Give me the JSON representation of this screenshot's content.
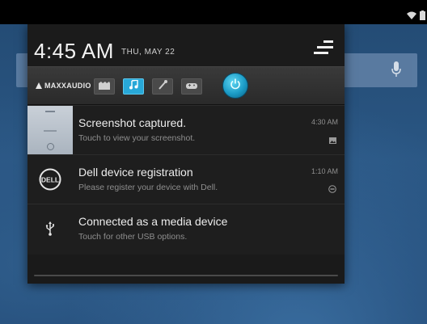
{
  "status_bar": {
    "icons": [
      "wifi-icon",
      "battery-icon"
    ]
  },
  "notification_header": {
    "time": "4:45 AM",
    "date": "THU, MAY 22",
    "quick_settings_icon": "quick-settings-icon"
  },
  "maxx_audio": {
    "label": "MAXXAUDIO",
    "presets": [
      {
        "icon": "movie-icon",
        "active": false
      },
      {
        "icon": "music-icon",
        "active": true
      },
      {
        "icon": "voice-icon",
        "active": false
      },
      {
        "icon": "game-icon",
        "active": false
      }
    ],
    "power_icon": "power-icon"
  },
  "notifications": [
    {
      "title": "Screenshot captured.",
      "subtitle": "Touch to view your screenshot.",
      "time": "4:30 AM",
      "icon": "screenshot-thumbnail",
      "small_icon": "image-icon"
    },
    {
      "title": "Dell device registration",
      "subtitle": "Please register your device with Dell.",
      "time": "1:10 AM",
      "icon": "dell-logo-icon",
      "small_icon": "dell-small-icon"
    },
    {
      "title": "Connected as a media device",
      "subtitle": "Touch for other USB options.",
      "time": "",
      "icon": "usb-icon",
      "small_icon": ""
    }
  ],
  "colors": {
    "accent": "#28a8d8",
    "shade_bg": "#1e1e1e",
    "wallpaper": "#2a5683"
  }
}
